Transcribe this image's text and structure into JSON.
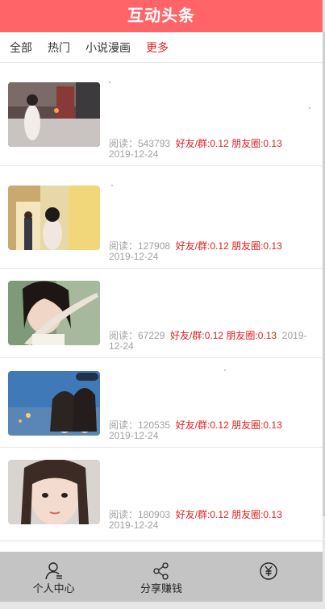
{
  "header": {
    "title": "互动头条"
  },
  "tabs": [
    {
      "label": "全部",
      "active": false
    },
    {
      "label": "热门",
      "active": false
    },
    {
      "label": "小说漫画",
      "active": false
    },
    {
      "label": "更多",
      "active": true
    }
  ],
  "articles": [
    {
      "read_label": "阅读：543793",
      "share_label": "好友/群:0.12 朋友圈:0.13",
      "date": "2019-12-24"
    },
    {
      "read_label": "阅读：127908",
      "share_label": "好友/群:0.12 朋友圈:0.13",
      "date": "2019-12-24"
    },
    {
      "read_label": "阅读：67229",
      "share_label": "好友/群:0.12 朋友圈:0.13",
      "date": "2019-12-24"
    },
    {
      "read_label": "阅读：120535",
      "share_label": "好友/群:0.12 朋友圈:0.13",
      "date": "2019-12-24"
    },
    {
      "read_label": "阅读：180903",
      "share_label": "好友/群:0.12 朋友圈:0.13",
      "date": "2019-12-24"
    }
  ],
  "bottom_nav": {
    "personal": "个人中心",
    "share": "分享赚钱",
    "money_icon": "yuan-circle-icon"
  },
  "colors": {
    "header_bg": "#ff6468",
    "accent_red": "#e02020",
    "nav_bg": "#c4c4c4",
    "muted_text": "#a0a0a0"
  }
}
